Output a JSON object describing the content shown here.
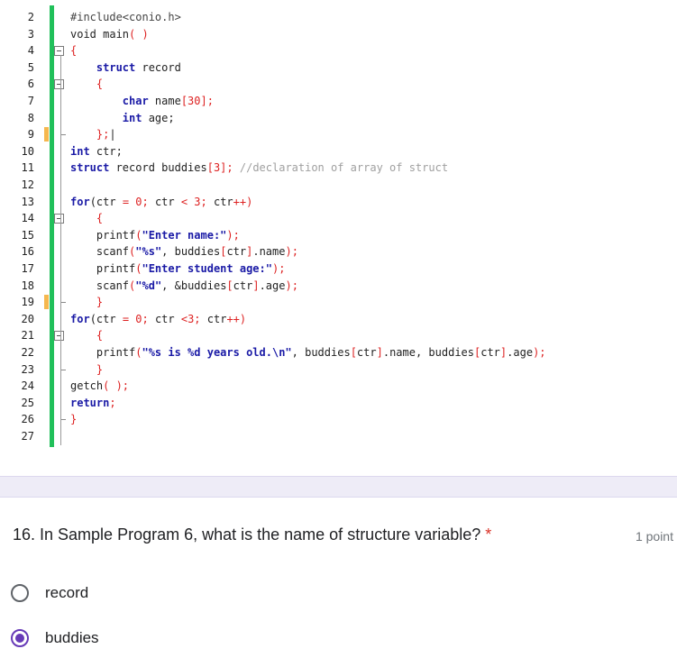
{
  "code": {
    "lines": [
      {
        "n": "2",
        "segments": [
          {
            "t": "#include<conio.h>",
            "c": "kw2"
          }
        ]
      },
      {
        "n": "3",
        "segments": [
          {
            "t": "void main",
            "c": "fn"
          },
          {
            "t": "( )",
            "c": "sym"
          }
        ]
      },
      {
        "n": "4",
        "segments": [
          {
            "t": "{",
            "c": "sym"
          }
        ]
      },
      {
        "n": "5",
        "segments": [
          {
            "t": "    struct",
            "c": "kw"
          },
          {
            "t": " record",
            "c": "fn"
          }
        ]
      },
      {
        "n": "6",
        "segments": [
          {
            "t": "    {",
            "c": "sym"
          }
        ]
      },
      {
        "n": "7",
        "segments": [
          {
            "t": "        char",
            "c": "kw"
          },
          {
            "t": " name",
            "c": "fn"
          },
          {
            "t": "[30];",
            "c": "sym"
          }
        ]
      },
      {
        "n": "8",
        "segments": [
          {
            "t": "        int",
            "c": "kw"
          },
          {
            "t": " age;",
            "c": "fn"
          }
        ]
      },
      {
        "n": "9",
        "segments": [
          {
            "t": "    };",
            "c": "sym"
          },
          {
            "t": "|",
            "c": "fn"
          }
        ]
      },
      {
        "n": "10",
        "segments": [
          {
            "t": "int",
            "c": "kw"
          },
          {
            "t": " ctr;",
            "c": "fn"
          }
        ]
      },
      {
        "n": "11",
        "segments": [
          {
            "t": "struct",
            "c": "kw"
          },
          {
            "t": " record buddies",
            "c": "fn"
          },
          {
            "t": "[3];",
            "c": "sym"
          },
          {
            "t": " //declaration of array of struct",
            "c": "cmt"
          }
        ]
      },
      {
        "n": "12",
        "segments": []
      },
      {
        "n": "13",
        "segments": [
          {
            "t": "for",
            "c": "kw"
          },
          {
            "t": "(ctr ",
            "c": "fn"
          },
          {
            "t": "= 0;",
            "c": "sym"
          },
          {
            "t": " ctr ",
            "c": "fn"
          },
          {
            "t": "< 3;",
            "c": "sym"
          },
          {
            "t": " ctr",
            "c": "fn"
          },
          {
            "t": "++)",
            "c": "sym"
          }
        ]
      },
      {
        "n": "14",
        "segments": [
          {
            "t": "    {",
            "c": "sym"
          }
        ]
      },
      {
        "n": "15",
        "segments": [
          {
            "t": "    printf",
            "c": "fn"
          },
          {
            "t": "(",
            "c": "sym"
          },
          {
            "t": "\"Enter name:\"",
            "c": "str"
          },
          {
            "t": ");",
            "c": "sym"
          }
        ]
      },
      {
        "n": "16",
        "segments": [
          {
            "t": "    scanf",
            "c": "fn"
          },
          {
            "t": "(",
            "c": "sym"
          },
          {
            "t": "\"%s\"",
            "c": "str"
          },
          {
            "t": ", buddies",
            "c": "fn"
          },
          {
            "t": "[",
            "c": "sym"
          },
          {
            "t": "ctr",
            "c": "fn"
          },
          {
            "t": "]",
            "c": "sym"
          },
          {
            "t": ".name",
            "c": "fn"
          },
          {
            "t": ");",
            "c": "sym"
          }
        ]
      },
      {
        "n": "17",
        "segments": [
          {
            "t": "    printf",
            "c": "fn"
          },
          {
            "t": "(",
            "c": "sym"
          },
          {
            "t": "\"Enter student age:\"",
            "c": "str"
          },
          {
            "t": ");",
            "c": "sym"
          }
        ]
      },
      {
        "n": "18",
        "segments": [
          {
            "t": "    scanf",
            "c": "fn"
          },
          {
            "t": "(",
            "c": "sym"
          },
          {
            "t": "\"%d\"",
            "c": "str"
          },
          {
            "t": ", &buddies",
            "c": "fn"
          },
          {
            "t": "[",
            "c": "sym"
          },
          {
            "t": "ctr",
            "c": "fn"
          },
          {
            "t": "]",
            "c": "sym"
          },
          {
            "t": ".age",
            "c": "fn"
          },
          {
            "t": ");",
            "c": "sym"
          }
        ]
      },
      {
        "n": "19",
        "segments": [
          {
            "t": "    }",
            "c": "sym"
          }
        ]
      },
      {
        "n": "20",
        "segments": [
          {
            "t": "for",
            "c": "kw"
          },
          {
            "t": "(ctr ",
            "c": "fn"
          },
          {
            "t": "= 0;",
            "c": "sym"
          },
          {
            "t": " ctr ",
            "c": "fn"
          },
          {
            "t": "<3;",
            "c": "sym"
          },
          {
            "t": " ctr",
            "c": "fn"
          },
          {
            "t": "++)",
            "c": "sym"
          }
        ]
      },
      {
        "n": "21",
        "segments": [
          {
            "t": "    {",
            "c": "sym"
          }
        ]
      },
      {
        "n": "22",
        "segments": [
          {
            "t": "    printf",
            "c": "fn"
          },
          {
            "t": "(",
            "c": "sym"
          },
          {
            "t": "\"%s is %d years old.\\n\"",
            "c": "str"
          },
          {
            "t": ", buddies",
            "c": "fn"
          },
          {
            "t": "[",
            "c": "sym"
          },
          {
            "t": "ctr",
            "c": "fn"
          },
          {
            "t": "]",
            "c": "sym"
          },
          {
            "t": ".name, buddies",
            "c": "fn"
          },
          {
            "t": "[",
            "c": "sym"
          },
          {
            "t": "ctr",
            "c": "fn"
          },
          {
            "t": "]",
            "c": "sym"
          },
          {
            "t": ".age",
            "c": "fn"
          },
          {
            "t": ");",
            "c": "sym"
          }
        ]
      },
      {
        "n": "23",
        "segments": [
          {
            "t": "    }",
            "c": "sym"
          }
        ]
      },
      {
        "n": "24",
        "segments": [
          {
            "t": "getch",
            "c": "fn"
          },
          {
            "t": "( );",
            "c": "sym"
          }
        ]
      },
      {
        "n": "25",
        "segments": [
          {
            "t": "return",
            "c": "kw"
          },
          {
            "t": ";",
            "c": "sym"
          }
        ]
      },
      {
        "n": "26",
        "segments": [
          {
            "t": "}",
            "c": "sym"
          }
        ]
      },
      {
        "n": "27",
        "segments": []
      }
    ],
    "colors": {
      "accent_bar": "#21c05a",
      "change_marker": "#f5b74e"
    }
  },
  "question": {
    "number_title": "16.  In Sample Program 6, what is the name of structure variable?",
    "required_mark": "*",
    "points": "1 point",
    "options": [
      {
        "label": "record",
        "selected": false
      },
      {
        "label": "buddies",
        "selected": true
      }
    ],
    "accent_color": "#673ab7"
  }
}
